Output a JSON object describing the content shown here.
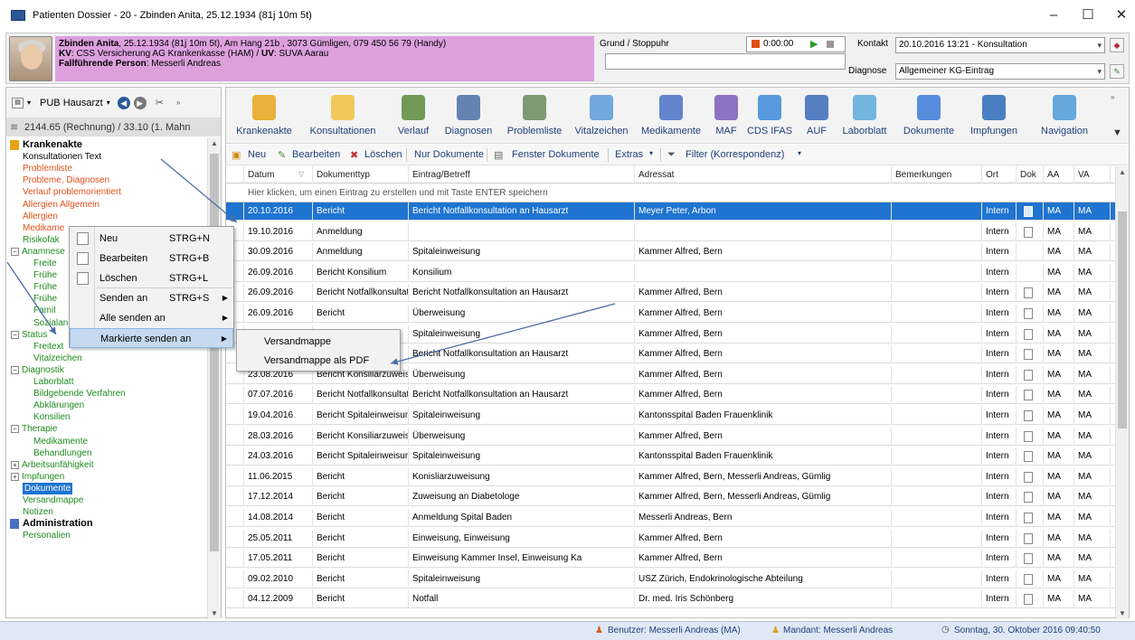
{
  "window": {
    "title": "Patienten Dossier - 20 - Zbinden Anita, 25.12.1934 (81j 10m 5t)",
    "minimize": "–",
    "maximize": "☐",
    "close": "✕"
  },
  "patient": {
    "line1_name": "Zbinden Anita",
    "line1_rest": ", 25.12.1934 (81j 10m 5t), Am Hang 21b , 3073 Gümligen, 079 450 56 79 (Handy)",
    "line2_kv_label": "KV",
    "line2_kv": ": CSS Versicherung AG Krankenkasse (HAM) / ",
    "line2_uv_label": "UV",
    "line2_uv": ": SUVA Aarau",
    "line3_label": "Fallführende Person",
    "line3_value": ": Messerli Andreas"
  },
  "header": {
    "grund_label": "Grund / Stoppuhr",
    "timer": "0:00:00",
    "kontakt_label": "Kontakt",
    "kontakt_value": "20.10.2016 13:21 - Konsultation",
    "diagnose_label": "Diagnose",
    "diagnose_value": "Allgemeiner KG-Eintrag"
  },
  "left_toolbar": {
    "dropdown": "PUB Hausarzt",
    "balance": "2144.65 (Rechnung) / 33.10 (1. Mahn"
  },
  "tree": [
    {
      "label": "Krankenakte",
      "style": "bold",
      "indent": 0
    },
    {
      "label": "Konsultationen Text",
      "style": "normal",
      "indent": 1
    },
    {
      "label": "Problemliste",
      "style": "red",
      "indent": 1
    },
    {
      "label": "Probleme, Diagnosen",
      "style": "red",
      "indent": 1
    },
    {
      "label": "Verlauf problemorientiert",
      "style": "red",
      "indent": 1
    },
    {
      "label": "Allergien Allgemein",
      "style": "red",
      "indent": 1
    },
    {
      "label": "Allergien",
      "style": "red",
      "indent": 1
    },
    {
      "label": "Medikame",
      "style": "red",
      "indent": 1
    },
    {
      "label": "Risikofak",
      "style": "green",
      "indent": 1
    },
    {
      "label": "Anamnese",
      "style": "green",
      "indent": 0
    },
    {
      "label": "Freite",
      "style": "green",
      "indent": 2
    },
    {
      "label": "Frühe",
      "style": "green",
      "indent": 2
    },
    {
      "label": "Frühe",
      "style": "green",
      "indent": 2
    },
    {
      "label": "Frühe",
      "style": "green",
      "indent": 2
    },
    {
      "label": "Famil",
      "style": "green",
      "indent": 2
    },
    {
      "label": "Sozialanamnese",
      "style": "green",
      "indent": 2
    },
    {
      "label": "Status",
      "style": "green",
      "indent": 0
    },
    {
      "label": "Freitext",
      "style": "green",
      "indent": 2
    },
    {
      "label": "Vitalzeichen",
      "style": "green",
      "indent": 2
    },
    {
      "label": "Diagnostik",
      "style": "green",
      "indent": 0
    },
    {
      "label": "Laborblatt",
      "style": "green",
      "indent": 2
    },
    {
      "label": "Bildgebende Verfahren",
      "style": "green",
      "indent": 2
    },
    {
      "label": "Abklärungen",
      "style": "green",
      "indent": 2
    },
    {
      "label": "Konsilien",
      "style": "green",
      "indent": 2
    },
    {
      "label": "Therapie",
      "style": "green",
      "indent": 0
    },
    {
      "label": "Medikamente",
      "style": "green",
      "indent": 2
    },
    {
      "label": "Behandlungen",
      "style": "green",
      "indent": 2
    },
    {
      "label": "Arbeitsunfähigkeit",
      "style": "green",
      "indent": 0
    },
    {
      "label": "Impfungen",
      "style": "green",
      "indent": 0
    },
    {
      "label": "Dokumente",
      "style": "sel",
      "indent": 1
    },
    {
      "label": "Versandmappe",
      "style": "green",
      "indent": 1
    },
    {
      "label": "Notizen",
      "style": "green",
      "indent": 1
    },
    {
      "label": "Administration",
      "style": "bold",
      "indent": 0
    },
    {
      "label": "Personalien",
      "style": "green",
      "indent": 1
    }
  ],
  "context_menu": [
    {
      "label": "Neu",
      "shortcut": "STRG+N",
      "icon": "new-document-icon"
    },
    {
      "label": "Bearbeiten",
      "shortcut": "STRG+B",
      "icon": "edit-icon"
    },
    {
      "label": "Löschen",
      "shortcut": "STRG+L",
      "icon": "delete-icon"
    },
    {
      "label": "Senden an",
      "shortcut": "STRG+S",
      "icon": ""
    },
    {
      "label": "Alle senden an",
      "shortcut": "",
      "icon": ""
    },
    {
      "label": "Markierte senden an",
      "shortcut": "",
      "icon": ""
    }
  ],
  "submenu": [
    "Versandmappe",
    "Versandmappe als PDF"
  ],
  "toolbar": [
    {
      "label": "Krankenakte",
      "icon": "folder-icon",
      "color": "#e8a317"
    },
    {
      "label": "Konsultationen",
      "icon": "clipboard-icon",
      "color": "#f0c040"
    },
    {
      "label": "Verlauf",
      "icon": "note-edit-icon",
      "color": "#5a8a3a"
    },
    {
      "label": "Diagnosen",
      "icon": "stethoscope-icon",
      "color": "#4a6fa5"
    },
    {
      "label": "Problemliste",
      "icon": "list-icon",
      "color": "#6a8a5a"
    },
    {
      "label": "Vitalzeichen",
      "icon": "thermometer-icon",
      "color": "#5a9ad8"
    },
    {
      "label": "Medikamente",
      "icon": "medicine-bottle-icon",
      "color": "#4a6fc5"
    },
    {
      "label": "MAF",
      "icon": "pill-icon",
      "color": "#7a5ab8"
    },
    {
      "label": "CDS IFAS",
      "icon": "pen-icon",
      "color": "#3a8ad8"
    },
    {
      "label": "AUF",
      "icon": "crutch-icon",
      "color": "#3a6ab8"
    },
    {
      "label": "Laborblatt",
      "icon": "flask-icon",
      "color": "#5aaad8"
    },
    {
      "label": "Dokumente",
      "icon": "document-box-icon",
      "color": "#3a7ad8"
    },
    {
      "label": "Impfungen",
      "icon": "syringe-icon",
      "color": "#2a6ab8"
    },
    {
      "label": "Navigation",
      "icon": "magnifier-icon",
      "color": "#4a9ad8"
    }
  ],
  "subtoolbar": {
    "neu": "Neu",
    "bearbeiten": "Bearbeiten",
    "loeschen": "Löschen",
    "nur_dokumente": "Nur Dokumente",
    "fenster_dokumente": "Fenster Dokumente",
    "extras": "Extras",
    "filter": "Filter (Korrespondenz)"
  },
  "grid": {
    "columns": [
      "Datum",
      "Dokumenttyp",
      "Eintrag/Betreff",
      "Adressat",
      "Bemerkungen",
      "Ort",
      "Dok",
      "AA",
      "VA"
    ],
    "new_row_hint": "Hier klicken, um einen Eintrag zu erstellen und mit Taste ENTER speichern",
    "rows": [
      [
        "20.10.2016",
        "Bericht",
        "Bericht Notfallkonsultation an Hausarzt",
        "Meyer Peter, Arbon",
        "",
        "Intern",
        "doc",
        "MA",
        "MA"
      ],
      [
        "19.10.2016",
        "Anmeldung",
        "",
        "",
        "",
        "Intern",
        "doc",
        "MA",
        "MA"
      ],
      [
        "30.09.2016",
        "Anmeldung",
        "Spitaleinweisung",
        "Kammer Alfred, Bern",
        "",
        "Intern",
        "",
        "MA",
        "MA"
      ],
      [
        "26.09.2016",
        "Bericht Konsilium",
        "Konsilium",
        "",
        "",
        "Intern",
        "",
        "MA",
        "MA"
      ],
      [
        "26.09.2016",
        "Bericht Notfallkonsultatio",
        "Bericht Notfallkonsultation an Hausarzt",
        "Kammer Alfred, Bern",
        "",
        "Intern",
        "doc",
        "MA",
        "MA"
      ],
      [
        "26.09.2016",
        "Bericht",
        "Überweisung",
        "Kammer Alfred, Bern",
        "",
        "Intern",
        "doc",
        "MA",
        "MA"
      ],
      [
        "",
        "sung",
        "Spitaleinweisung",
        "Kammer Alfred, Bern",
        "",
        "Intern",
        "doc",
        "MA",
        "MA"
      ],
      [
        "",
        "ltatio",
        "Bericht Notfallkonsultation an Hausarzt",
        "Kammer Alfred, Bern",
        "",
        "Intern",
        "doc",
        "MA",
        "MA"
      ],
      [
        "23.08.2016",
        "Bericht Konsiliarzuweisu",
        "Überweisung",
        "Kammer Alfred, Bern",
        "",
        "Intern",
        "doc",
        "MA",
        "MA"
      ],
      [
        "07.07.2016",
        "Bericht Notfallkonsultatio",
        "Bericht Notfallkonsultation an Hausarzt",
        "Kammer Alfred, Bern",
        "",
        "Intern",
        "doc",
        "MA",
        "MA"
      ],
      [
        "19.04.2016",
        "Bericht Spitaleinweisung",
        "Spitaleinweisung",
        "Kantonsspital Baden Frauenklinik",
        "",
        "Intern",
        "doc",
        "MA",
        "MA"
      ],
      [
        "28.03.2016",
        "Bericht Konsiliarzuweisu",
        "Überweisung",
        "Kammer Alfred, Bern",
        "",
        "Intern",
        "doc",
        "MA",
        "MA"
      ],
      [
        "24.03.2016",
        "Bericht Spitaleinweisung",
        "Spitaleinweisung",
        "Kantonsspital Baden Frauenklinik",
        "",
        "Intern",
        "doc",
        "MA",
        "MA"
      ],
      [
        "11.06.2015",
        "Bericht",
        "Konisliarzuweisung",
        "Kammer Alfred, Bern, Messerli Andreas, Gümlig",
        "",
        "Intern",
        "doc",
        "MA",
        "MA"
      ],
      [
        "17.12.2014",
        "Bericht",
        "Zuweisung an Diabetologe",
        "Kammer Alfred, Bern, Messerli Andreas, Gümlig",
        "",
        "Intern",
        "doc",
        "MA",
        "MA"
      ],
      [
        "14.08.2014",
        "Bericht",
        "Anmeldung Spital Baden",
        "Messerli Andreas, Bern",
        "",
        "Intern",
        "doc",
        "MA",
        "MA"
      ],
      [
        "25.05.2011",
        "Bericht",
        "Einweisung, Einweisung",
        "Kammer Alfred, Bern",
        "",
        "Intern",
        "doc",
        "MA",
        "MA"
      ],
      [
        "17.05.2011",
        "Bericht",
        "Einweisung Kammer Insel, Einweisung Ka",
        "Kammer Alfred, Bern",
        "",
        "Intern",
        "doc",
        "MA",
        "MA"
      ],
      [
        "09.02.2010",
        "Bericht",
        "Spitaleinweisung",
        "USZ Zürich, Endokrinologische Abteilung",
        "",
        "Intern",
        "doc",
        "MA",
        "MA"
      ],
      [
        "04.12.2009",
        "Bericht",
        "Notfall",
        "Dr. med. Iris Schönberg",
        "",
        "Intern",
        "doc",
        "MA",
        "MA"
      ]
    ]
  },
  "status": {
    "user": "Benutzer: Messerli Andreas  (MA)",
    "mandant": "Mandant: Messerli Andreas",
    "datetime": "Sonntag, 30. Oktober 2016 09:40:50"
  },
  "colors": {
    "accent": "#1e74d0",
    "patient_banner": "#dda0dd",
    "tree_red": "#e0501a",
    "tree_green": "#1e8c1e"
  }
}
